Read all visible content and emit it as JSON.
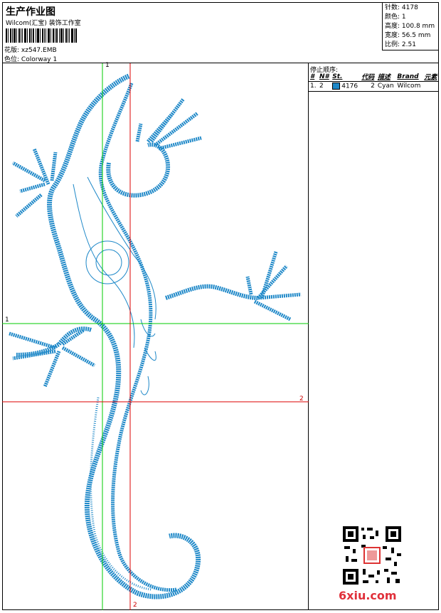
{
  "header": {
    "title": "生产作业图",
    "subtitle": "Wilcom(汇宝) 装饰工作室",
    "design_label": "花版:",
    "design_file": "xz547.EMB",
    "color_label": "色位:",
    "colorway": "Colorway 1"
  },
  "stats": {
    "stitches_label": "针数:",
    "stitches": "4178",
    "colors_label": "颜色:",
    "colors": "1",
    "height_label": "高度:",
    "height": "100.8 mm",
    "width_label": "宽度:",
    "width": "56.5 mm",
    "ratio_label": "比例:",
    "ratio": "2.51"
  },
  "stop_sequence": {
    "title": "停止顺序:",
    "columns": [
      "#",
      "N#",
      "St.",
      "代码",
      "描述",
      "Brand",
      "元素"
    ],
    "rows": [
      {
        "idx": "1.",
        "n": "2",
        "st": "4176",
        "code": "2",
        "desc": "Cyan",
        "brand": "Wilcom",
        "element": ""
      }
    ]
  },
  "grid_labels": {
    "top": "1",
    "left": "1",
    "right": "2",
    "bottom": "2"
  },
  "watermark": {
    "site": "6xiu.com"
  },
  "colors": {
    "thread": "#1e88c8",
    "guide_green": "#00cc00",
    "guide_red": "#dd0000",
    "swatch": "#1e88c8"
  }
}
